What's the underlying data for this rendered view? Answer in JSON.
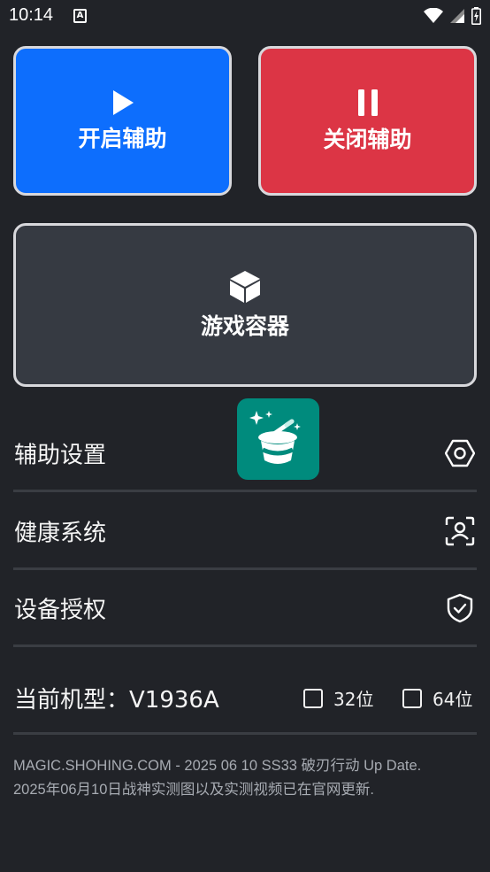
{
  "status_bar": {
    "time": "10:14",
    "notification_letter": "A"
  },
  "buttons": {
    "start_label": "开启辅助",
    "stop_label": "关闭辅助",
    "container_label": "游戏容器"
  },
  "menu": {
    "items": [
      {
        "label": "辅助设置",
        "icon": "hexagon-gear-icon"
      },
      {
        "label": "健康系统",
        "icon": "face-scan-icon"
      },
      {
        "label": "设备授权",
        "icon": "shield-check-icon"
      }
    ]
  },
  "model": {
    "label": "当前机型：V1936A",
    "opt32": "32位",
    "opt64": "64位",
    "opt32_checked": false,
    "opt64_checked": false
  },
  "footer": {
    "line1": "MAGIC.SHOHING.COM - 2025 06 10 SS33 破刃行动 Up Date.",
    "line2": "2025年06月10日战神实测图以及实测视频已在官网更新."
  },
  "colors": {
    "background": "#212328",
    "start": "#0d6efd",
    "stop": "#dc3545",
    "container": "#363a42",
    "floating_app": "#008b7d"
  }
}
